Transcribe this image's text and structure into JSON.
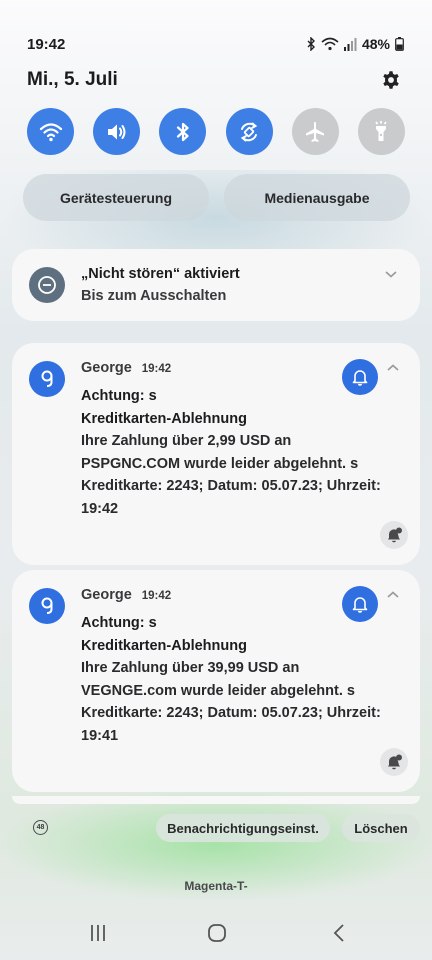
{
  "status": {
    "time": "19:42",
    "battery": "48%"
  },
  "header": {
    "date": "Mi., 5. Juli"
  },
  "quick_toggles": [
    {
      "icon": "wifi-icon",
      "state": "on"
    },
    {
      "icon": "sound-icon",
      "state": "on"
    },
    {
      "icon": "bluetooth-icon",
      "state": "on"
    },
    {
      "icon": "auto-rotate-icon",
      "state": "on"
    },
    {
      "icon": "airplane-mode-icon",
      "state": "off"
    },
    {
      "icon": "flashlight-icon",
      "state": "off"
    }
  ],
  "device_buttons": {
    "device_control": "Gerätesteuerung",
    "media_output": "Medienausgabe"
  },
  "dnd": {
    "title": "„Nicht stören“ aktiviert",
    "subtitle": "Bis zum Ausschalten"
  },
  "notifications": [
    {
      "app": "George",
      "time": "19:42",
      "title_line1": "Achtung: s",
      "title_line2": "Kreditkarten-Ablehnung",
      "line1": "Ihre Zahlung über 2,99 USD an",
      "line2": "PSPGNC.COM wurde leider abgelehnt. s",
      "line3": "Kreditkarte: 2243; Datum: 05.07.23; Uhrzeit:",
      "line4": "19:42"
    },
    {
      "app": "George",
      "time": "19:42",
      "title_line1": "Achtung: s",
      "title_line2": "Kreditkarten-Ablehnung",
      "line1": "Ihre Zahlung über 39,99 USD an",
      "line2": "VEGNGE.com wurde leider abgelehnt. s",
      "line3": "Kreditkarte: 2243; Datum: 05.07.23; Uhrzeit:",
      "line4": "19:41"
    }
  ],
  "footer": {
    "count": "48",
    "settings_label": "Benachrichtigungseinst.",
    "clear_label": "Löschen",
    "carrier": "Magenta-T-"
  },
  "colors": {
    "accent": "#3e7fe6",
    "app_blue": "#2f6fe0",
    "toggle_off": "#c9cbcd"
  }
}
